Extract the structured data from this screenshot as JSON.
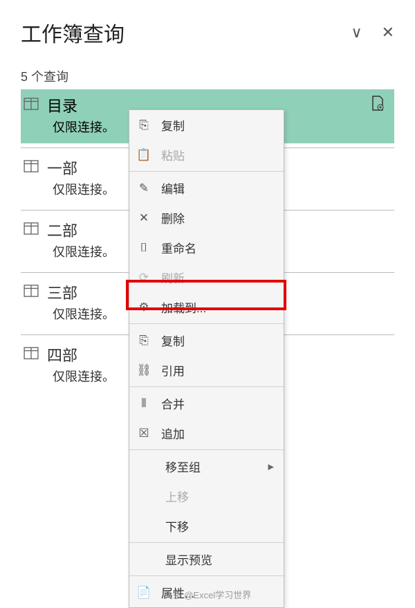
{
  "panel": {
    "title": "工作簿查询",
    "chevron": "∨",
    "close": "✕",
    "query_count_label": "5 个查询"
  },
  "queries": [
    {
      "name": "目录",
      "conn": "仅限连接。",
      "selected": true,
      "extra_icon": true
    },
    {
      "name": "一部",
      "conn": "仅限连接。",
      "selected": false
    },
    {
      "name": "二部",
      "conn": "仅限连接。",
      "selected": false
    },
    {
      "name": "三部",
      "conn": "仅限连接。",
      "selected": false
    },
    {
      "name": "四部",
      "conn": "仅限连接。",
      "selected": false
    }
  ],
  "context_menu": [
    {
      "icon": "copy",
      "label": "复制"
    },
    {
      "icon": "paste",
      "label": "粘贴",
      "disabled": true
    },
    {
      "sep": true
    },
    {
      "icon": "edit",
      "label": "编辑"
    },
    {
      "icon": "delete",
      "label": "删除"
    },
    {
      "icon": "rename",
      "label": "重命名"
    },
    {
      "icon": "refresh",
      "label": "刷新",
      "disabled": true
    },
    {
      "icon": "loadto",
      "label": "加载到...",
      "highlight": true
    },
    {
      "sep": true
    },
    {
      "icon": "duplicate",
      "label": "复制"
    },
    {
      "icon": "link",
      "label": "引用"
    },
    {
      "sep": true
    },
    {
      "icon": "merge",
      "label": "合并"
    },
    {
      "icon": "append",
      "label": "追加"
    },
    {
      "sep": true
    },
    {
      "label": "移至组",
      "indent": true,
      "arrow": true
    },
    {
      "label": "上移",
      "indent": true,
      "disabled": true
    },
    {
      "label": "下移",
      "indent": true
    },
    {
      "sep": true
    },
    {
      "label": "显示预览",
      "indent": true
    },
    {
      "sep": true
    },
    {
      "icon": "properties",
      "label": "属性..."
    }
  ],
  "icons": {
    "copy": "⎘",
    "paste": "📋",
    "edit": "✎",
    "delete": "✕",
    "rename": "⌷",
    "refresh": "⟳",
    "loadto": "⚙",
    "duplicate": "⎘",
    "link": "⛓",
    "merge": "⫴",
    "append": "☒",
    "properties": "📄"
  },
  "footer": "头条 @Excel学习世界"
}
